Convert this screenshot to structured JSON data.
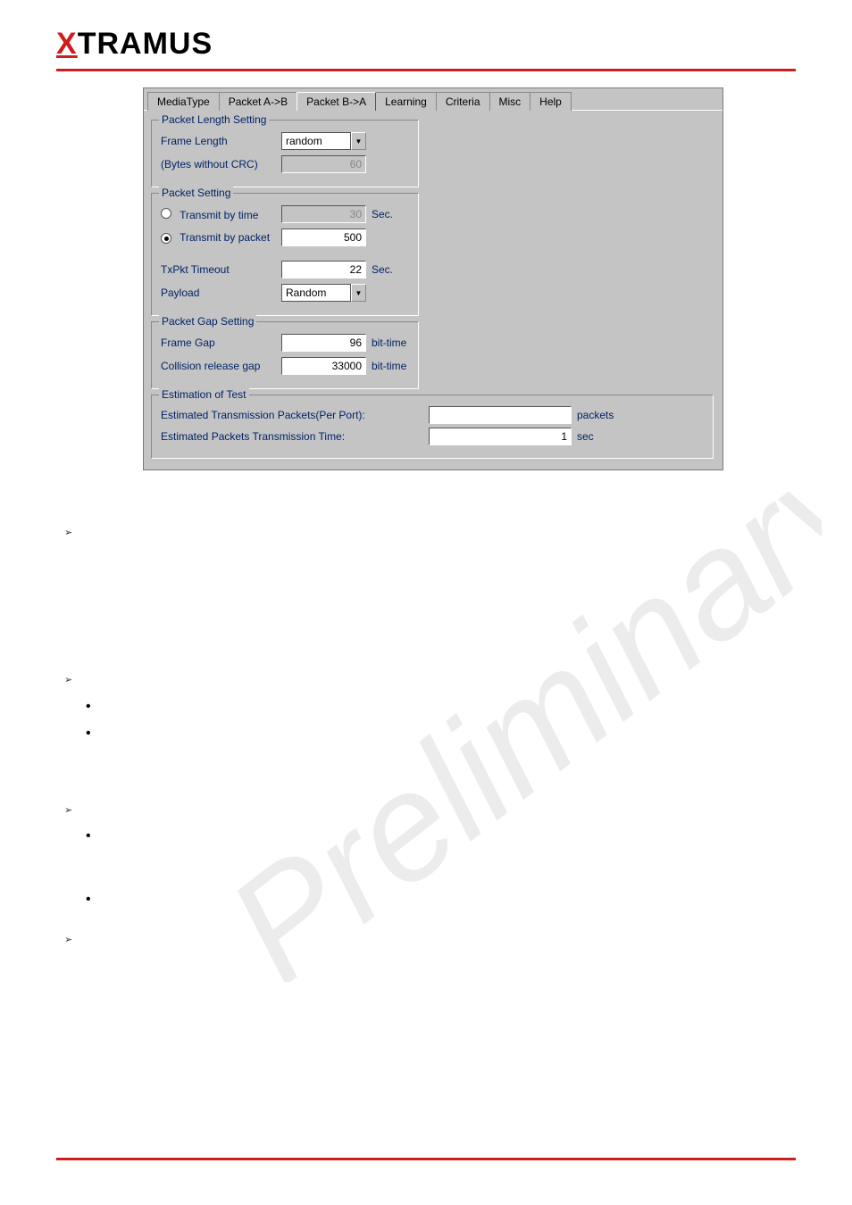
{
  "logo": {
    "x": "X",
    "rest": "TRAMUS"
  },
  "tabs": {
    "media": "MediaType",
    "ab": "Packet A->B",
    "ba": "Packet B->A",
    "learning": "Learning",
    "criteria": "Criteria",
    "misc": "Misc",
    "help": "Help"
  },
  "groups": {
    "pkt_len": {
      "title": "Packet Length Setting",
      "frame_length_label": "Frame Length",
      "frame_length_value": "random",
      "bytes_label": "(Bytes without CRC)",
      "bytes_value": "60"
    },
    "pkt_set": {
      "title": "Packet Setting",
      "by_time_label": "Transmit by time",
      "by_time_value": "30",
      "by_time_unit": "Sec.",
      "by_packet_label": "Transmit by packet",
      "by_packet_value": "500",
      "txpkt_label": "TxPkt Timeout",
      "txpkt_value": "22",
      "txpkt_unit": "Sec.",
      "payload_label": "Payload",
      "payload_value": "Random"
    },
    "gap": {
      "title": "Packet Gap Setting",
      "frame_gap_label": "Frame Gap",
      "frame_gap_value": "96",
      "frame_gap_unit": "bit-time",
      "collision_label": "Collision release gap",
      "collision_value": "33000",
      "collision_unit": "bit-time"
    },
    "est": {
      "title": "Estimation of Test",
      "pkts_label": "Estimated Transmission Packets(Per Port):",
      "pkts_value": "",
      "pkts_unit": "packets",
      "time_label": "Estimated Packets Transmission Time:",
      "time_value": "1",
      "time_unit": "sec"
    }
  },
  "watermark_text": "Preliminary",
  "bullet_glyphs": {
    "chevron": "➢",
    "dot": "•"
  }
}
